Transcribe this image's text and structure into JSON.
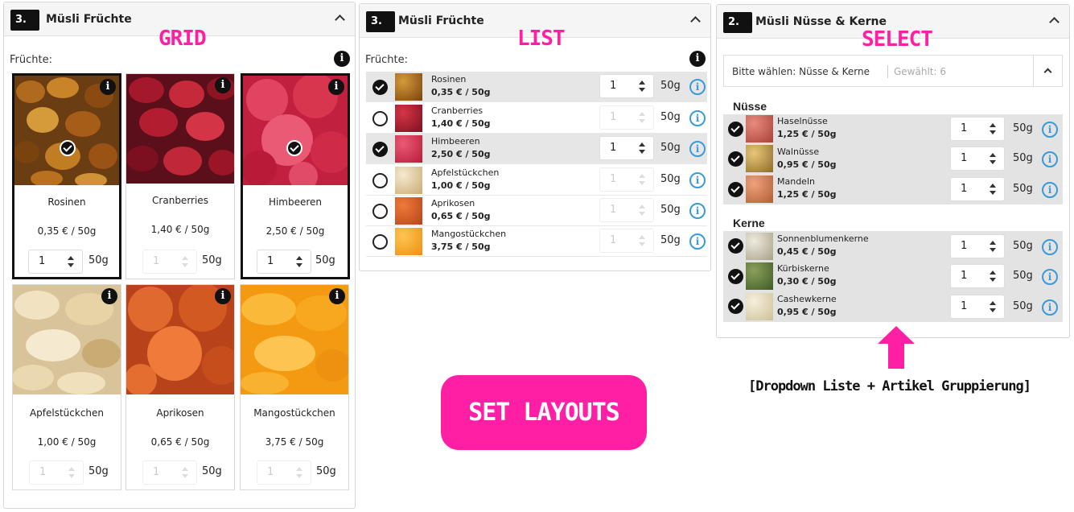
{
  "grid_panel": {
    "step": "3.",
    "title": "Müsli Früchte",
    "layout_label": "GRID",
    "section_label": "Früchte:",
    "items": [
      {
        "name": "Rosinen",
        "price": "0,35 € / 50g",
        "qty": "1",
        "unit": "50g",
        "selected": true
      },
      {
        "name": "Cranberries",
        "price": "1,40 € / 50g",
        "qty": "1",
        "unit": "50g",
        "selected": false
      },
      {
        "name": "Himbeeren",
        "price": "2,50 € / 50g",
        "qty": "1",
        "unit": "50g",
        "selected": true
      },
      {
        "name": "Apfelstückchen",
        "price": "1,00 € / 50g",
        "qty": "1",
        "unit": "50g",
        "selected": false
      },
      {
        "name": "Aprikosen",
        "price": "0,65 € / 50g",
        "qty": "1",
        "unit": "50g",
        "selected": false
      },
      {
        "name": "Mangostückchen",
        "price": "3,75 € / 50g",
        "qty": "1",
        "unit": "50g",
        "selected": false
      }
    ]
  },
  "list_panel": {
    "step": "3.",
    "title": "Müsli Früchte",
    "layout_label": "LIST",
    "section_label": "Früchte:",
    "items": [
      {
        "name": "Rosinen",
        "price": "0,35 € / 50g",
        "qty": "1",
        "unit": "50g",
        "selected": true
      },
      {
        "name": "Cranberries",
        "price": "1,40 € / 50g",
        "qty": "1",
        "unit": "50g",
        "selected": false
      },
      {
        "name": "Himbeeren",
        "price": "2,50 € / 50g",
        "qty": "1",
        "unit": "50g",
        "selected": true
      },
      {
        "name": "Apfelstückchen",
        "price": "1,00 € / 50g",
        "qty": "1",
        "unit": "50g",
        "selected": false
      },
      {
        "name": "Aprikosen",
        "price": "0,65 € / 50g",
        "qty": "1",
        "unit": "50g",
        "selected": false
      },
      {
        "name": "Mangostückchen",
        "price": "3,75 € / 50g",
        "qty": "1",
        "unit": "50g",
        "selected": false
      }
    ]
  },
  "select_panel": {
    "step": "2.",
    "title": "Müsli Nüsse & Kerne",
    "layout_label": "SELECT",
    "dropdown_label": "Bitte wählen: Nüsse & Kerne",
    "dropdown_count": "Gewählt: 6",
    "groups": [
      {
        "label": "Nüsse",
        "items": [
          {
            "name": "Haselnüsse",
            "price": "1,25 € / 50g",
            "qty": "1",
            "unit": "50g"
          },
          {
            "name": "Walnüsse",
            "price": "0,95 € / 50g",
            "qty": "1",
            "unit": "50g"
          },
          {
            "name": "Mandeln",
            "price": "1,25 € / 50g",
            "qty": "1",
            "unit": "50g"
          }
        ]
      },
      {
        "label": "Kerne",
        "items": [
          {
            "name": "Sonnenblumenkerne",
            "price": "0,45 € / 50g",
            "qty": "1",
            "unit": "50g"
          },
          {
            "name": "Kürbiskerne",
            "price": "0,30 € / 50g",
            "qty": "1",
            "unit": "50g"
          },
          {
            "name": "Cashewkerne",
            "price": "0,95 € / 50g",
            "qty": "1",
            "unit": "50g"
          }
        ]
      }
    ]
  },
  "cta_label": "SET LAYOUTS",
  "caption": "[Dropdown Liste + Artikel Gruppierung]",
  "icons": {
    "info": "i"
  },
  "colors": {
    "accent": "#ff1fa5",
    "info_blue": "#3a9ad9",
    "selected_row": "#e6e6e6"
  }
}
